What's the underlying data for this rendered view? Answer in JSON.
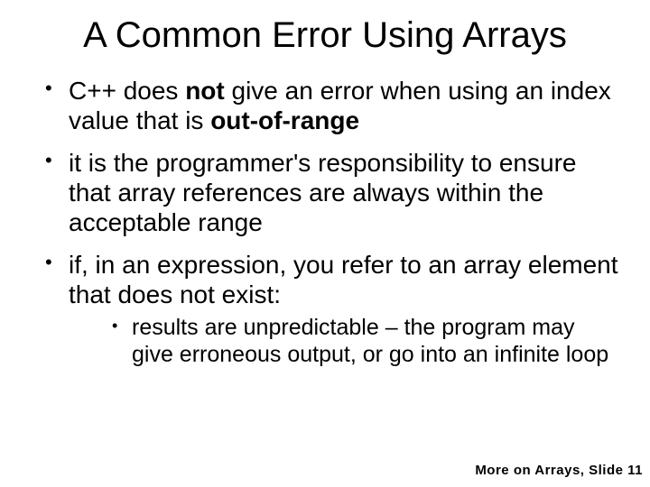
{
  "title": "A Common Error Using Arrays",
  "bullets": {
    "b1_a": "C++ does ",
    "b1_not": "not",
    "b1_b": " give an error when using an index value that is ",
    "b1_oor": "out-of-range",
    "b2": "it is the programmer's responsibility to ensure that array references are always within the acceptable range",
    "b3": "if, in an expression, you refer to an array element that does not exist:",
    "sub1": "results are unpredictable – the program may give erroneous output, or go into an infinite loop"
  },
  "footer": {
    "prefix": "More on Arrays, Slide ",
    "number": "11"
  }
}
